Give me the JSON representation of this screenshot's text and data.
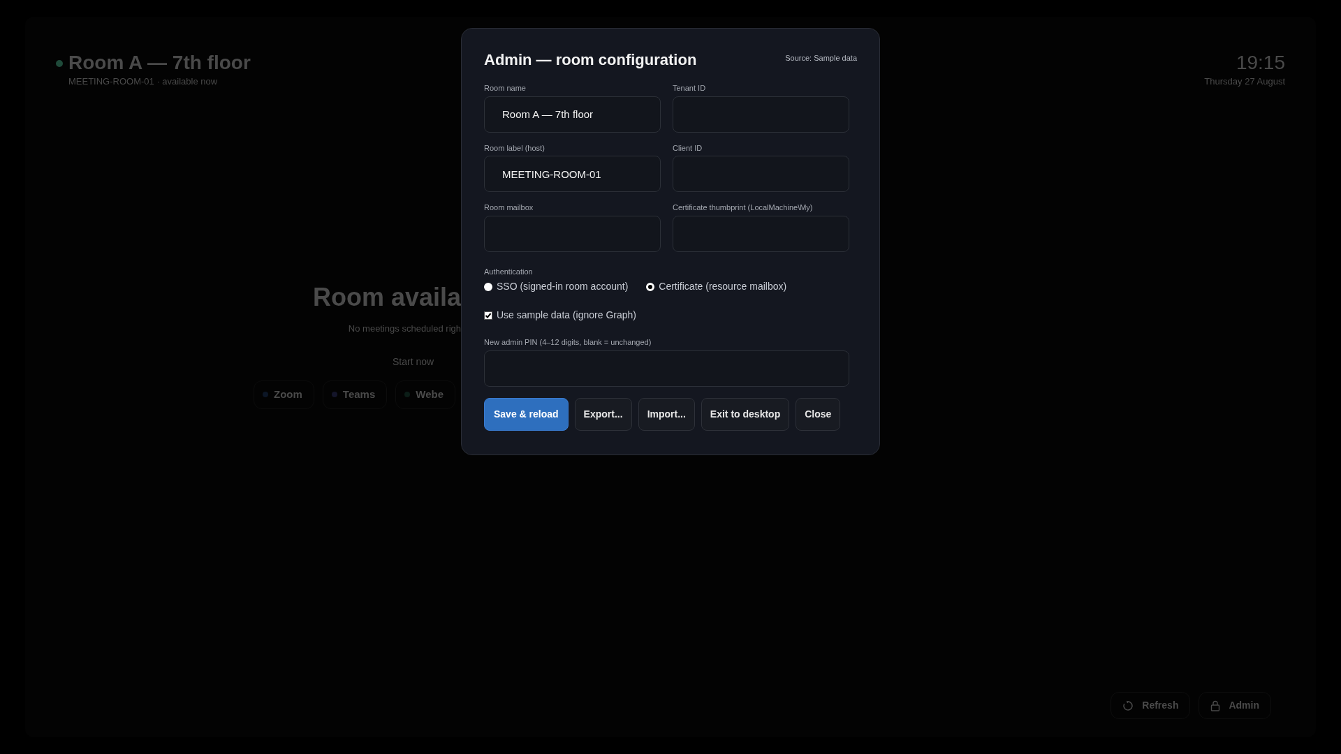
{
  "background": {
    "room_title": "Room A — 7th floor",
    "status_dot": {
      "color": "#1f4a3a"
    },
    "subtitle": "MEETING-ROOM-01 · available now",
    "clock": "19:15",
    "date": "Thursday 27 August",
    "status_heading": "Room availa",
    "status_text": "No meetings scheduled righ",
    "start_button": "Start now",
    "platforms": [
      {
        "label": "Zoom",
        "color": "#0c1626"
      },
      {
        "label": "Teams",
        "color": "#14152a"
      },
      {
        "label": "Webe",
        "color": "#0b1d17"
      }
    ],
    "footer_buttons": [
      {
        "label": "Refresh",
        "kind": "refresh"
      },
      {
        "label": "Admin",
        "kind": "admin"
      }
    ]
  },
  "dialog": {
    "title": "Admin — room configuration",
    "source": "Source: Sample data",
    "fields": [
      {
        "label": "Room name",
        "value": "Room A — 7th floor"
      },
      {
        "label": "Tenant ID"
      },
      {
        "label": "Room label (host)",
        "value": "MEETING-ROOM-01"
      },
      {
        "label": "Client ID"
      },
      {
        "label": "Room mailbox"
      },
      {
        "label": "Certificate thumbprint (LocalMachine\\My)"
      }
    ],
    "authentication": {
      "label": "Authentication",
      "options": [
        {
          "label": "SSO (signed-in room account)",
          "selected": false
        },
        {
          "label": "Certificate (resource mailbox)",
          "selected": true
        }
      ]
    },
    "sample_data": {
      "label": "Use sample data (ignore Graph)",
      "checked": true
    },
    "pin": {
      "label": "New admin PIN (4–12 digits, blank = unchanged)"
    },
    "buttons": [
      {
        "label": "Save & reload",
        "primary": true
      },
      {
        "label": "Export...",
        "primary": false
      },
      {
        "label": "Import...",
        "primary": false
      },
      {
        "label": "Exit to desktop",
        "primary": false
      },
      {
        "label": "Close",
        "primary": false
      }
    ]
  }
}
